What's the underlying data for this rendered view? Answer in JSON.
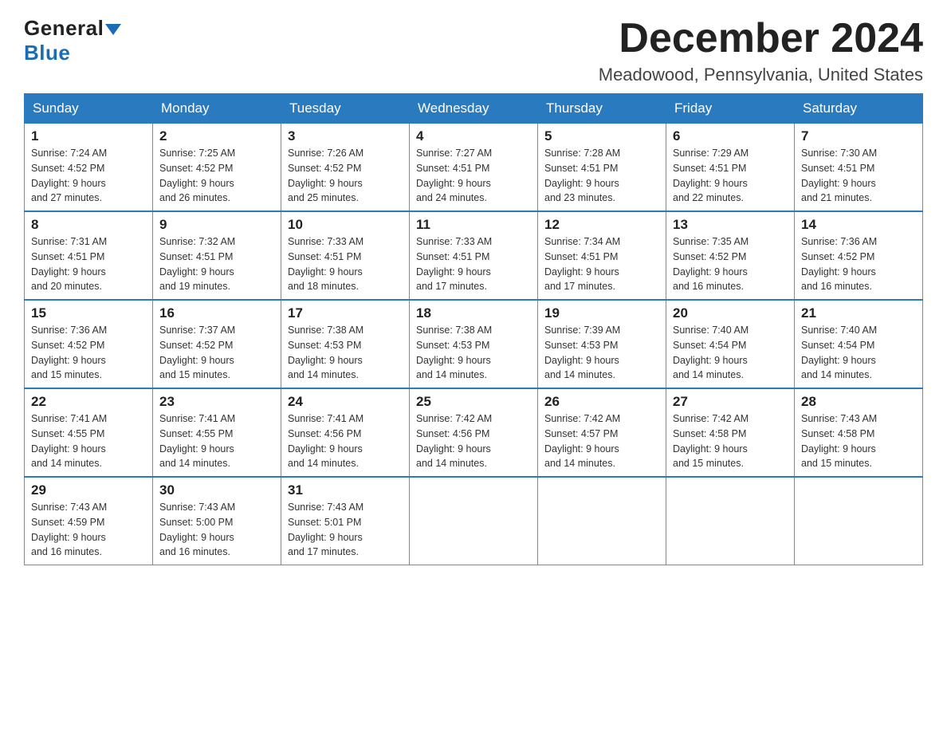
{
  "logo": {
    "general": "General",
    "blue": "Blue"
  },
  "title": {
    "month": "December 2024",
    "location": "Meadowood, Pennsylvania, United States"
  },
  "weekdays": [
    "Sunday",
    "Monday",
    "Tuesday",
    "Wednesday",
    "Thursday",
    "Friday",
    "Saturday"
  ],
  "weeks": [
    [
      {
        "day": "1",
        "sunrise": "7:24 AM",
        "sunset": "4:52 PM",
        "daylight": "9 hours and 27 minutes."
      },
      {
        "day": "2",
        "sunrise": "7:25 AM",
        "sunset": "4:52 PM",
        "daylight": "9 hours and 26 minutes."
      },
      {
        "day": "3",
        "sunrise": "7:26 AM",
        "sunset": "4:52 PM",
        "daylight": "9 hours and 25 minutes."
      },
      {
        "day": "4",
        "sunrise": "7:27 AM",
        "sunset": "4:51 PM",
        "daylight": "9 hours and 24 minutes."
      },
      {
        "day": "5",
        "sunrise": "7:28 AM",
        "sunset": "4:51 PM",
        "daylight": "9 hours and 23 minutes."
      },
      {
        "day": "6",
        "sunrise": "7:29 AM",
        "sunset": "4:51 PM",
        "daylight": "9 hours and 22 minutes."
      },
      {
        "day": "7",
        "sunrise": "7:30 AM",
        "sunset": "4:51 PM",
        "daylight": "9 hours and 21 minutes."
      }
    ],
    [
      {
        "day": "8",
        "sunrise": "7:31 AM",
        "sunset": "4:51 PM",
        "daylight": "9 hours and 20 minutes."
      },
      {
        "day": "9",
        "sunrise": "7:32 AM",
        "sunset": "4:51 PM",
        "daylight": "9 hours and 19 minutes."
      },
      {
        "day": "10",
        "sunrise": "7:33 AM",
        "sunset": "4:51 PM",
        "daylight": "9 hours and 18 minutes."
      },
      {
        "day": "11",
        "sunrise": "7:33 AM",
        "sunset": "4:51 PM",
        "daylight": "9 hours and 17 minutes."
      },
      {
        "day": "12",
        "sunrise": "7:34 AM",
        "sunset": "4:51 PM",
        "daylight": "9 hours and 17 minutes."
      },
      {
        "day": "13",
        "sunrise": "7:35 AM",
        "sunset": "4:52 PM",
        "daylight": "9 hours and 16 minutes."
      },
      {
        "day": "14",
        "sunrise": "7:36 AM",
        "sunset": "4:52 PM",
        "daylight": "9 hours and 16 minutes."
      }
    ],
    [
      {
        "day": "15",
        "sunrise": "7:36 AM",
        "sunset": "4:52 PM",
        "daylight": "9 hours and 15 minutes."
      },
      {
        "day": "16",
        "sunrise": "7:37 AM",
        "sunset": "4:52 PM",
        "daylight": "9 hours and 15 minutes."
      },
      {
        "day": "17",
        "sunrise": "7:38 AM",
        "sunset": "4:53 PM",
        "daylight": "9 hours and 14 minutes."
      },
      {
        "day": "18",
        "sunrise": "7:38 AM",
        "sunset": "4:53 PM",
        "daylight": "9 hours and 14 minutes."
      },
      {
        "day": "19",
        "sunrise": "7:39 AM",
        "sunset": "4:53 PM",
        "daylight": "9 hours and 14 minutes."
      },
      {
        "day": "20",
        "sunrise": "7:40 AM",
        "sunset": "4:54 PM",
        "daylight": "9 hours and 14 minutes."
      },
      {
        "day": "21",
        "sunrise": "7:40 AM",
        "sunset": "4:54 PM",
        "daylight": "9 hours and 14 minutes."
      }
    ],
    [
      {
        "day": "22",
        "sunrise": "7:41 AM",
        "sunset": "4:55 PM",
        "daylight": "9 hours and 14 minutes."
      },
      {
        "day": "23",
        "sunrise": "7:41 AM",
        "sunset": "4:55 PM",
        "daylight": "9 hours and 14 minutes."
      },
      {
        "day": "24",
        "sunrise": "7:41 AM",
        "sunset": "4:56 PM",
        "daylight": "9 hours and 14 minutes."
      },
      {
        "day": "25",
        "sunrise": "7:42 AM",
        "sunset": "4:56 PM",
        "daylight": "9 hours and 14 minutes."
      },
      {
        "day": "26",
        "sunrise": "7:42 AM",
        "sunset": "4:57 PM",
        "daylight": "9 hours and 14 minutes."
      },
      {
        "day": "27",
        "sunrise": "7:42 AM",
        "sunset": "4:58 PM",
        "daylight": "9 hours and 15 minutes."
      },
      {
        "day": "28",
        "sunrise": "7:43 AM",
        "sunset": "4:58 PM",
        "daylight": "9 hours and 15 minutes."
      }
    ],
    [
      {
        "day": "29",
        "sunrise": "7:43 AM",
        "sunset": "4:59 PM",
        "daylight": "9 hours and 16 minutes."
      },
      {
        "day": "30",
        "sunrise": "7:43 AM",
        "sunset": "5:00 PM",
        "daylight": "9 hours and 16 minutes."
      },
      {
        "day": "31",
        "sunrise": "7:43 AM",
        "sunset": "5:01 PM",
        "daylight": "9 hours and 17 minutes."
      },
      null,
      null,
      null,
      null
    ]
  ],
  "labels": {
    "sunrise": "Sunrise:",
    "sunset": "Sunset:",
    "daylight": "Daylight:"
  }
}
